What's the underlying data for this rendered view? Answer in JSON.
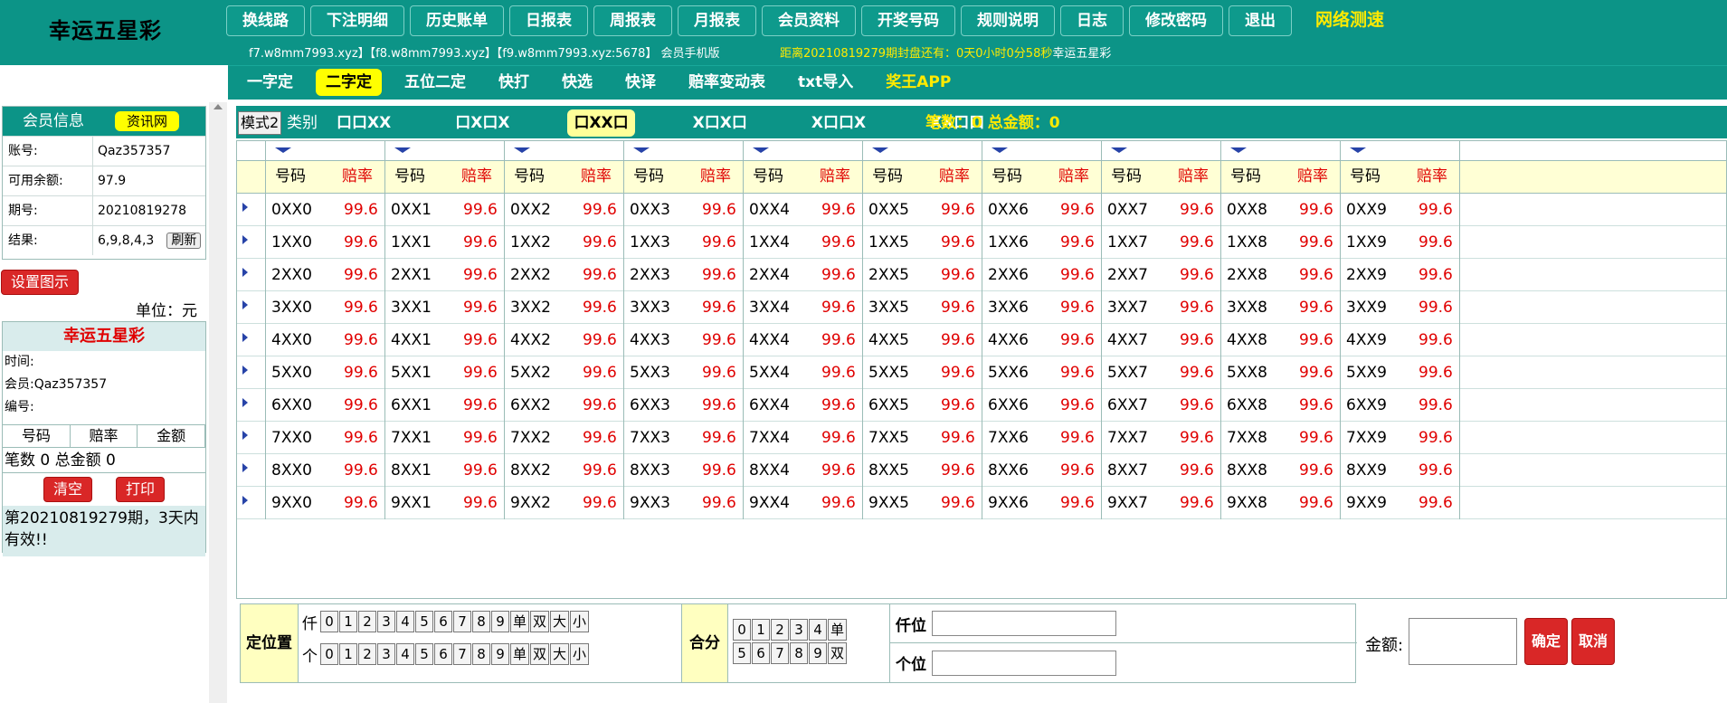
{
  "header": {
    "logo": "幸运五星彩",
    "nav": [
      "换线路",
      "下注明细",
      "历史账单",
      "日报表",
      "周报表",
      "月报表",
      "会员资料",
      "开奖号码",
      "规则说明",
      "日志",
      "修改密码",
      "退出"
    ],
    "speed_test": "网络测速",
    "sites": "f7.w8mm7993.xyz】【f8.w8mm7993.xyz】【f9.w8mm7993.xyz:5678】 会员手机版",
    "countdown": "距离20210819279期封盘还有：0天0小时0分58秒",
    "countdown_game": "幸运五星彩"
  },
  "subnav": [
    "一字定",
    "二字定",
    "五位二定",
    "快打",
    "快选",
    "快译",
    "赔率变动表",
    "txt导入",
    "奖王APP"
  ],
  "member": {
    "title": "会员信息",
    "badge": "资讯网",
    "account_label": "账号:",
    "account": "Qaz357357",
    "balance_label": "可用余额:",
    "balance": "97.9",
    "period_label": "期号:",
    "period": "20210819278",
    "result_label": "结果:",
    "result": "6,9,8,4,3",
    "refresh": "刷新"
  },
  "left": {
    "set_button": "设置图示",
    "unit": "单位：元"
  },
  "ticket": {
    "title": "幸运五星彩",
    "time": "时间:",
    "member": "会员:Qaz357357",
    "serial": "编号:",
    "col_number": "号码",
    "col_odds": "赔率",
    "col_amount": "金额",
    "count_line": "笔数 0 总金额 0",
    "clear": "清空",
    "print": "打印",
    "note": "第20210819279期，3天内有效!!"
  },
  "modebar": {
    "mode": "模式2",
    "type_label": "类别",
    "tabs": [
      "口口XX",
      "口X口X",
      "口XX口",
      "X口X口",
      "X口口X",
      "XX口口"
    ],
    "summary": "笔数：0 总金额：0"
  },
  "grid": {
    "header_number": "号码",
    "header_odds": "赔率",
    "odds": "99.6",
    "rows": [
      [
        "0XX0",
        "0XX1",
        "0XX2",
        "0XX3",
        "0XX4",
        "0XX5",
        "0XX6",
        "0XX7",
        "0XX8",
        "0XX9"
      ],
      [
        "1XX0",
        "1XX1",
        "1XX2",
        "1XX3",
        "1XX4",
        "1XX5",
        "1XX6",
        "1XX7",
        "1XX8",
        "1XX9"
      ],
      [
        "2XX0",
        "2XX1",
        "2XX2",
        "2XX3",
        "2XX4",
        "2XX5",
        "2XX6",
        "2XX7",
        "2XX8",
        "2XX9"
      ],
      [
        "3XX0",
        "3XX1",
        "3XX2",
        "3XX3",
        "3XX4",
        "3XX5",
        "3XX6",
        "3XX7",
        "3XX8",
        "3XX9"
      ],
      [
        "4XX0",
        "4XX1",
        "4XX2",
        "4XX3",
        "4XX4",
        "4XX5",
        "4XX6",
        "4XX7",
        "4XX8",
        "4XX9"
      ],
      [
        "5XX0",
        "5XX1",
        "5XX2",
        "5XX3",
        "5XX4",
        "5XX5",
        "5XX6",
        "5XX7",
        "5XX8",
        "5XX9"
      ],
      [
        "6XX0",
        "6XX1",
        "6XX2",
        "6XX3",
        "6XX4",
        "6XX5",
        "6XX6",
        "6XX7",
        "6XX8",
        "6XX9"
      ],
      [
        "7XX0",
        "7XX1",
        "7XX2",
        "7XX3",
        "7XX4",
        "7XX5",
        "7XX6",
        "7XX7",
        "7XX8",
        "7XX9"
      ],
      [
        "8XX0",
        "8XX1",
        "8XX2",
        "8XX3",
        "8XX4",
        "8XX5",
        "8XX6",
        "8XX7",
        "8XX8",
        "8XX9"
      ],
      [
        "9XX0",
        "9XX1",
        "9XX2",
        "9XX3",
        "9XX4",
        "9XX5",
        "9XX6",
        "9XX7",
        "9XX8",
        "9XX9"
      ]
    ]
  },
  "bottom": {
    "position_label": "定位置",
    "thousand": "仟",
    "unit": "个",
    "digits": [
      "0",
      "1",
      "2",
      "3",
      "4",
      "5",
      "6",
      "7",
      "8",
      "9",
      "单",
      "双",
      "大",
      "小"
    ],
    "hefen_label": "合分",
    "hefen_row1": [
      "0",
      "1",
      "2",
      "3",
      "4",
      "单"
    ],
    "hefen_row2": [
      "5",
      "6",
      "7",
      "8",
      "9",
      "双"
    ],
    "thousand_pos": "仟位",
    "unit_pos": "个位",
    "amount_label": "金额:",
    "confirm": "确定",
    "cancel": "取消"
  }
}
